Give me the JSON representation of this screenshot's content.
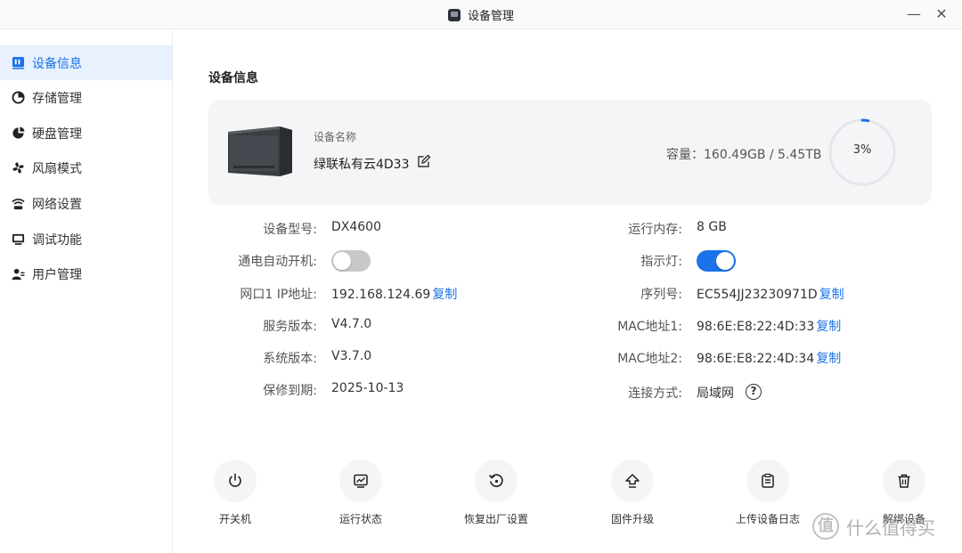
{
  "window": {
    "title": "设备管理",
    "minimize_glyph": "—",
    "close_glyph": "✕"
  },
  "sidebar": {
    "items": [
      {
        "label": "设备信息",
        "icon": "device-info-icon",
        "active": true
      },
      {
        "label": "存储管理",
        "icon": "storage-pie-icon",
        "active": false
      },
      {
        "label": "硬盘管理",
        "icon": "disk-icon",
        "active": false
      },
      {
        "label": "风扇模式",
        "icon": "fan-icon",
        "active": false
      },
      {
        "label": "网络设置",
        "icon": "network-icon",
        "active": false
      },
      {
        "label": "调试功能",
        "icon": "debug-icon",
        "active": false
      },
      {
        "label": "用户管理",
        "icon": "users-icon",
        "active": false
      }
    ]
  },
  "main": {
    "section_title": "设备信息",
    "device": {
      "name_label": "设备名称",
      "name_value": "绿联私有云4D33",
      "capacity_text": "容量：160.49GB / 5.45TB",
      "usage_percent_text": "3%",
      "usage_fraction": 0.03
    },
    "left_rows": [
      {
        "label": "设备型号:",
        "value": "DX4600"
      },
      {
        "label": "通电自动开机:",
        "toggle": "off"
      },
      {
        "label": "网口1 IP地址:",
        "value": "192.168.124.69",
        "copy": "复制"
      },
      {
        "label": "服务版本:",
        "value": "V4.7.0"
      },
      {
        "label": "系统版本:",
        "value": "V3.7.0"
      },
      {
        "label": "保修到期:",
        "value": "2025-10-13"
      }
    ],
    "right_rows": [
      {
        "label": "运行内存:",
        "value": "8 GB"
      },
      {
        "label": "指示灯:",
        "toggle": "on"
      },
      {
        "label": "序列号:",
        "value": "EC554JJ23230971D",
        "copy": "复制"
      },
      {
        "label": "MAC地址1:",
        "value": "98:6E:E8:22:4D:33",
        "copy": "复制"
      },
      {
        "label": "MAC地址2:",
        "value": "98:6E:E8:22:4D:34",
        "copy": "复制"
      },
      {
        "label": "连接方式:",
        "value": "局域网",
        "help": "?"
      }
    ],
    "actions": [
      {
        "label": "开关机",
        "icon": "power-icon"
      },
      {
        "label": "运行状态",
        "icon": "monitor-status-icon"
      },
      {
        "label": "恢复出厂设置",
        "icon": "factory-reset-icon"
      },
      {
        "label": "固件升级",
        "icon": "upgrade-icon"
      },
      {
        "label": "上传设备日志",
        "icon": "upload-log-icon"
      },
      {
        "label": "解绑设备",
        "icon": "trash-icon"
      }
    ]
  },
  "watermark": {
    "text": "什么值得买",
    "mark": "值"
  },
  "colors": {
    "accent": "#1a73e8",
    "active_bg": "#e8f1fd",
    "card_bg": "#f4f5f7",
    "toggle_off": "#c8c8c8"
  }
}
